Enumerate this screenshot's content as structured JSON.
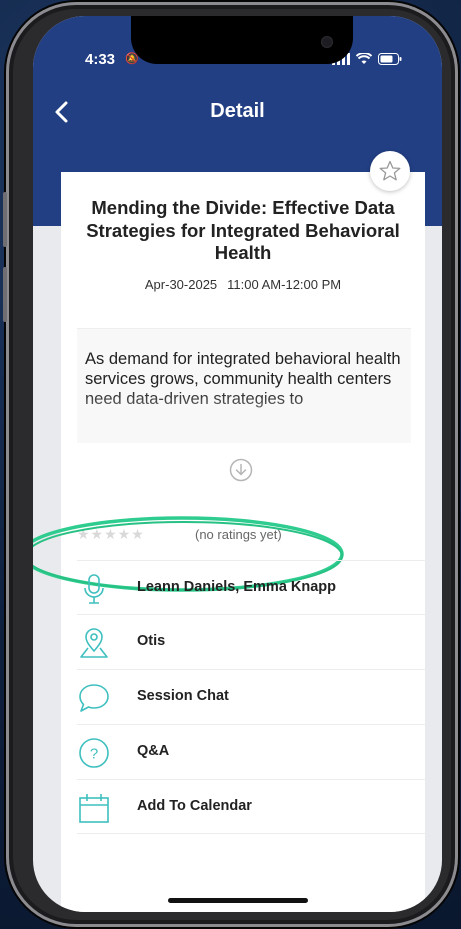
{
  "status": {
    "time": "4:33"
  },
  "nav": {
    "title": "Detail"
  },
  "session": {
    "title": "Mending the Divide: Effective Data Strategies for Integrated Behavioral Health",
    "date": "Apr-30-2025",
    "time": "11:00 AM-12:00 PM",
    "description": "As demand for integrated behavioral health services grows, community health centers need data-driven strategies to"
  },
  "rating": {
    "stars": 0,
    "max_stars": 5,
    "label": "(no ratings yet)"
  },
  "items": [
    {
      "label": "Leann Daniels, Emma Knapp",
      "icon": "microphone-icon"
    },
    {
      "label": "Otis",
      "icon": "map-pin-icon"
    },
    {
      "label": "Session Chat",
      "icon": "chat-bubble-icon"
    },
    {
      "label": "Q&A",
      "icon": "question-icon"
    },
    {
      "label": "Add To Calendar",
      "icon": "calendar-icon"
    }
  ],
  "colors": {
    "header": "#223f84",
    "accent_teal": "#3fbfbf",
    "highlight_green": "#2ecc8f"
  }
}
